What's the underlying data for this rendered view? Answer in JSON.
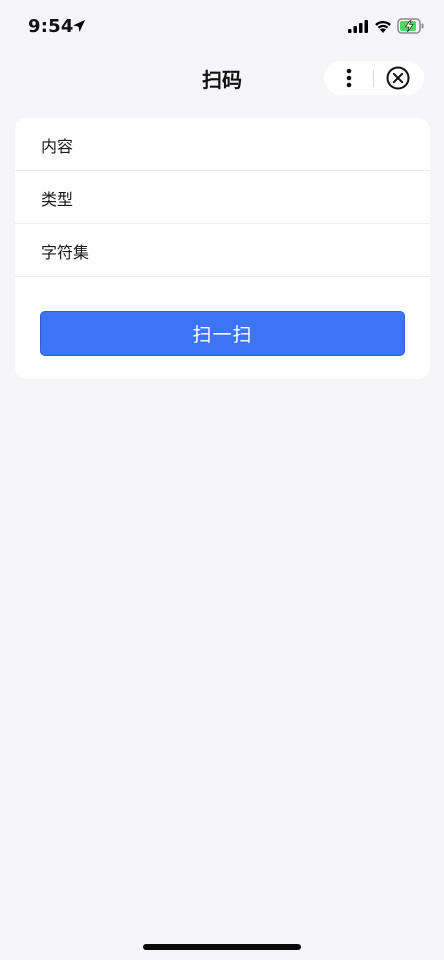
{
  "status_bar": {
    "time": "9:54",
    "icons": [
      "location-arrow-icon",
      "cellular-signal-icon",
      "wifi-icon",
      "battery-charging-icon"
    ],
    "battery_color": "#4cd964"
  },
  "nav": {
    "title": "扫码",
    "more_icon": "more-dots-icon",
    "close_icon": "close-circle-icon"
  },
  "form": {
    "fields": [
      {
        "label": "内容",
        "value": ""
      },
      {
        "label": "类型",
        "value": ""
      },
      {
        "label": "字符集",
        "value": ""
      }
    ],
    "scan_button_label": "扫一扫"
  },
  "colors": {
    "accent": "#3d74f5",
    "page_background": "#f6f5f8",
    "card_background": "#ffffff"
  }
}
